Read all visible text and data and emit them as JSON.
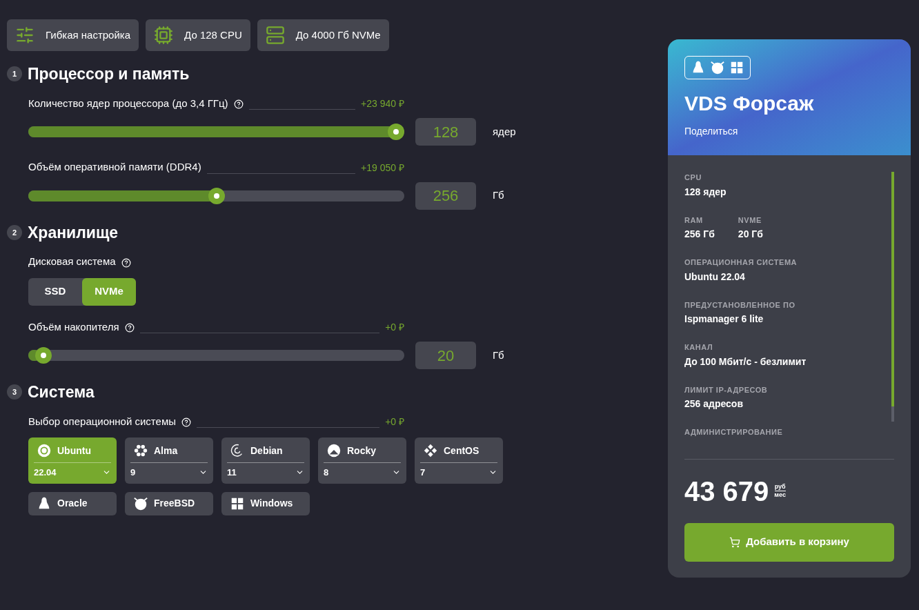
{
  "features": [
    "Гибкая настройка",
    "До 128 CPU",
    "До 4000 Гб NVMe"
  ],
  "sections": [
    {
      "number": "1",
      "title": "Процессор и память",
      "blocks": [
        {
          "kind": "slider",
          "label": "Количество ядер процессора (до 3,4 ГГц)",
          "help": true,
          "price": "+23 940 ₽",
          "level": 1,
          "value": "128",
          "unit": "ядер"
        },
        {
          "kind": "slider",
          "label": "Объём оперативной памяти (DDR4)",
          "help": false,
          "price": "+19 050 ₽",
          "level": 0.5,
          "value": "256",
          "unit": "Гб"
        }
      ]
    },
    {
      "number": "2",
      "title": "Хранилище",
      "blocks": [
        {
          "kind": "toggle",
          "label": "Дисковая система",
          "help": true,
          "options": [
            {
              "label": "SSD",
              "selected": false
            },
            {
              "label": "NVMe",
              "selected": true
            }
          ]
        },
        {
          "kind": "slider",
          "label": "Объём накопителя",
          "help": true,
          "price": "+0 ₽",
          "level": 0.02,
          "value": "20",
          "unit": "Гб"
        }
      ]
    },
    {
      "number": "3",
      "title": "Система",
      "blocks": [
        {
          "kind": "os",
          "label": "Выбор операционной системы",
          "help": true,
          "price": "+0 ₽",
          "options": [
            {
              "name": "Ubuntu",
              "version": "22.04",
              "selected": true
            },
            {
              "name": "Alma",
              "version": "9",
              "selected": false
            },
            {
              "name": "Debian",
              "version": "11",
              "selected": false
            },
            {
              "name": "Rocky",
              "version": "8",
              "selected": false
            },
            {
              "name": "CentOS",
              "version": "7",
              "selected": false
            },
            {
              "name": "Oracle",
              "selected": false
            },
            {
              "name": "FreeBSD",
              "selected": false
            },
            {
              "name": "Windows",
              "selected": false
            }
          ]
        }
      ]
    }
  ],
  "summary": {
    "title": "VDS Форсаж",
    "share": "Поделиться",
    "specs": [
      [
        {
          "label": "CPU",
          "value": "128 ядер"
        }
      ],
      [
        {
          "label": "RAM",
          "value": "256 Гб"
        },
        {
          "label": "NVME",
          "value": "20 Гб"
        }
      ],
      [
        {
          "label": "ОПЕРАЦИОННАЯ СИСТЕМА",
          "value": "Ubuntu 22.04"
        }
      ],
      [
        {
          "label": "ПРЕДУСТАНОВЛЕННОЕ ПО",
          "value": "Ispmanager 6 lite"
        }
      ],
      [
        {
          "label": "КАНАЛ",
          "value": "До 100 Мбит/с - безлимит"
        }
      ],
      [
        {
          "label": "ЛИМИТ IP-АДРЕСОВ",
          "value": "256 адресов"
        }
      ],
      [
        {
          "label": "АДМИНИСТРИРОВАНИЕ"
        }
      ]
    ],
    "price": "43 679",
    "currency": "руб",
    "period": "мес",
    "button": "Добавить в корзину"
  }
}
